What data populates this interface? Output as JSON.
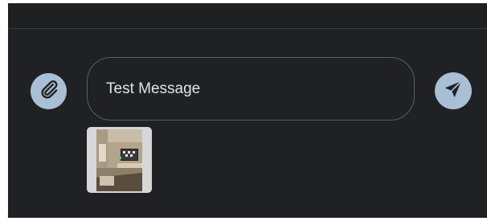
{
  "composer": {
    "message_value": "Test Message",
    "attach_icon": "paperclip-icon",
    "send_icon": "send-icon",
    "accent_color": "#a9bfd3",
    "field_border_color": "#4e6275"
  },
  "attachments": [
    {
      "type": "image",
      "icon": "image-thumbnail"
    }
  ]
}
